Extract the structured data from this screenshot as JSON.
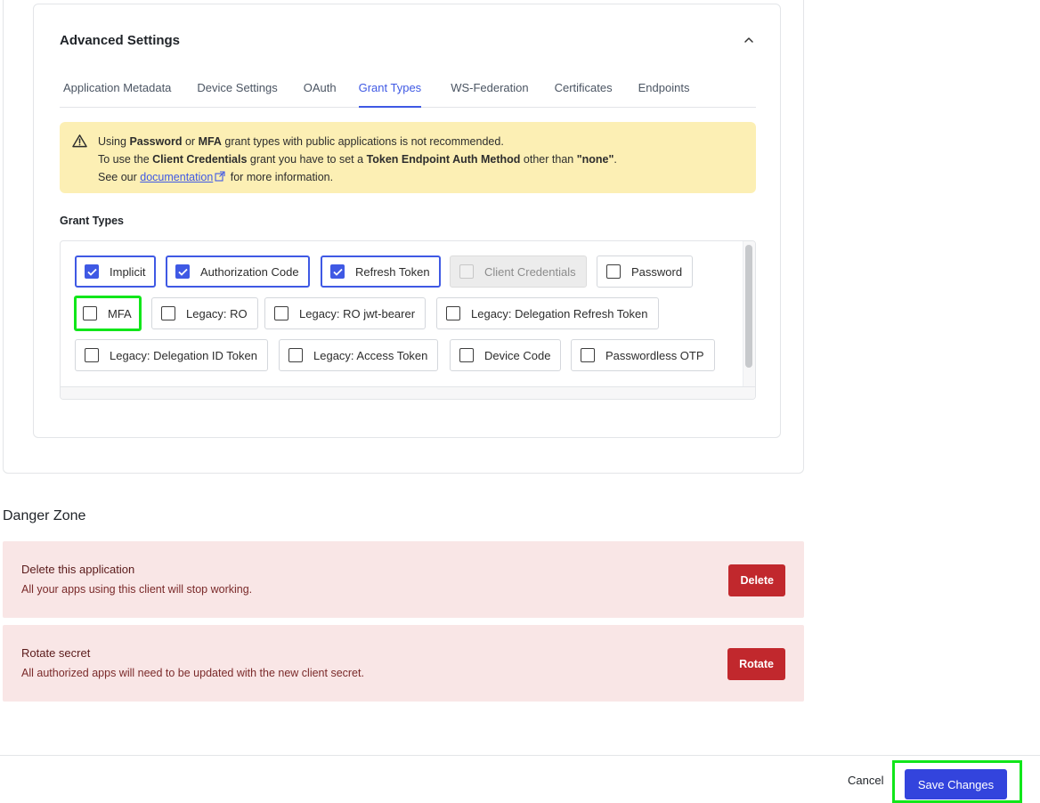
{
  "advanced": {
    "title": "Advanced Settings",
    "tabs": [
      {
        "label": "Application Metadata"
      },
      {
        "label": "Device Settings"
      },
      {
        "label": "OAuth"
      },
      {
        "label": "Grant Types",
        "active": true
      },
      {
        "label": "WS-Federation"
      },
      {
        "label": "Certificates"
      },
      {
        "label": "Endpoints"
      }
    ]
  },
  "alert": {
    "line1_a": "Using ",
    "line1_b": "Password",
    "line1_c": " or ",
    "line1_d": "MFA",
    "line1_e": " grant types with public applications is not recommended.",
    "line2_a": "To use the ",
    "line2_b": "Client Credentials",
    "line2_c": " grant you have to set a ",
    "line2_d": "Token Endpoint Auth Method",
    "line2_e": " other than ",
    "line2_f": "\"none\"",
    "line2_g": ".",
    "line3_a": "See our ",
    "line3_link": "documentation",
    "line3_b": " for more information."
  },
  "grant_types": {
    "label": "Grant Types",
    "items": [
      {
        "label": "Implicit",
        "checked": true
      },
      {
        "label": "Authorization Code",
        "checked": true
      },
      {
        "label": "Refresh Token",
        "checked": true
      },
      {
        "label": "Client Credentials",
        "checked": false,
        "disabled": true
      },
      {
        "label": "Password",
        "checked": false
      },
      {
        "label": "MFA",
        "checked": false
      },
      {
        "label": "Legacy: RO",
        "checked": false
      },
      {
        "label": "Legacy: RO jwt-bearer",
        "checked": false
      },
      {
        "label": "Legacy: Delegation Refresh Token",
        "checked": false
      },
      {
        "label": "Legacy: Delegation ID Token",
        "checked": false
      },
      {
        "label": "Legacy: Access Token",
        "checked": false
      },
      {
        "label": "Device Code",
        "checked": false
      },
      {
        "label": "Passwordless OTP",
        "checked": false
      }
    ]
  },
  "danger": {
    "title": "Danger Zone",
    "delete": {
      "title": "Delete this application",
      "desc": "All your apps using this client will stop working.",
      "button": "Delete"
    },
    "rotate": {
      "title": "Rotate secret",
      "desc": "All authorized apps will need to be updated with the new client secret.",
      "button": "Rotate"
    }
  },
  "footer": {
    "cancel": "Cancel",
    "save": "Save Changes"
  },
  "colors": {
    "accent": "#3f59e4",
    "danger": "#c1282d",
    "highlight": "#11e61a",
    "alert_bg": "#fcefb4",
    "danger_bg": "#f9e6e6"
  }
}
